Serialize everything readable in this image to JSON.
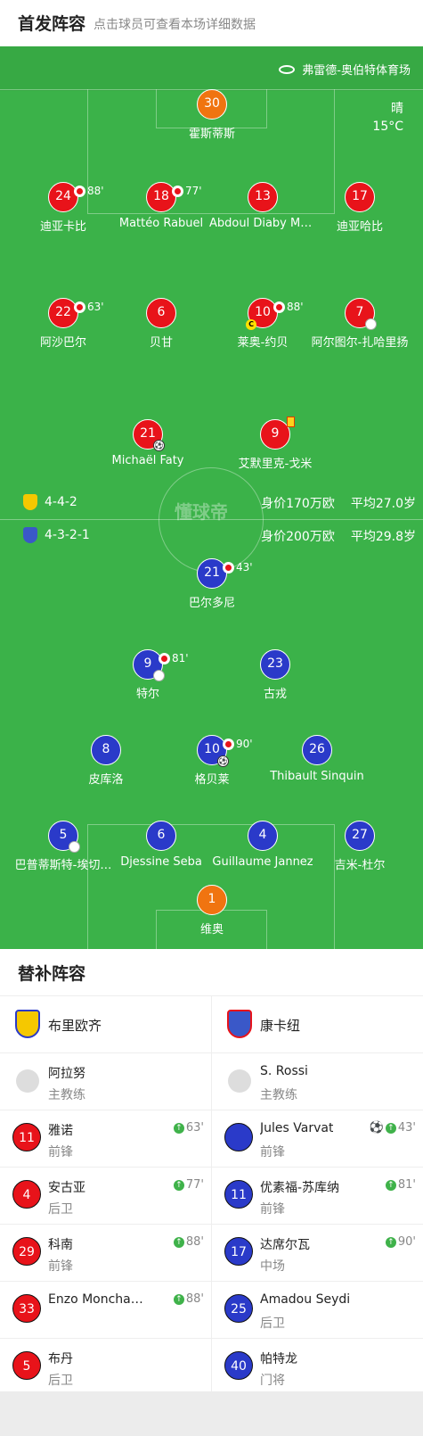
{
  "header": {
    "title": "首发阵容",
    "subtitle": "点击球员可查看本场详细数据"
  },
  "venue": {
    "name": "弗雷德-奥伯特体育场"
  },
  "weather": {
    "condition": "晴",
    "temp": "15°C"
  },
  "watermark": "懂球帝",
  "home": {
    "formation": "4-4-2",
    "value": "身价170万欧",
    "avg_age": "平均27.0岁",
    "players": [
      {
        "number": "30",
        "name": "霍斯蒂斯",
        "color": "orange"
      },
      {
        "number": "24",
        "name": "迪亚卡比",
        "sub": "88'"
      },
      {
        "number": "18",
        "name": "Mattéo Rabuel",
        "sub": "77'"
      },
      {
        "number": "13",
        "name": "Abdoul Diaby Ma…"
      },
      {
        "number": "17",
        "name": "迪亚哈比"
      },
      {
        "number": "22",
        "name": "阿沙巴尔",
        "sub": "63'"
      },
      {
        "number": "6",
        "name": "贝甘"
      },
      {
        "number": "10",
        "name": "莱奥-约贝",
        "sub": "88'",
        "captain": "C"
      },
      {
        "number": "7",
        "name": "阿尔图尔-扎哈里扬"
      },
      {
        "number": "21",
        "name": "Michaël Faty"
      },
      {
        "number": "9",
        "name": "艾默里克-戈米"
      }
    ]
  },
  "away": {
    "formation": "4-3-2-1",
    "value": "身价200万欧",
    "avg_age": "平均29.8岁",
    "players": [
      {
        "number": "21",
        "name": "巴尔多尼",
        "sub": "43'"
      },
      {
        "number": "9",
        "name": "特尔",
        "sub": "81'"
      },
      {
        "number": "23",
        "name": "古戎"
      },
      {
        "number": "8",
        "name": "皮库洛"
      },
      {
        "number": "10",
        "name": "格贝莱",
        "sub": "90'"
      },
      {
        "number": "26",
        "name": "Thibault Sinquin"
      },
      {
        "number": "5",
        "name": "巴普蒂斯特-埃切…"
      },
      {
        "number": "6",
        "name": "Djessine Seba"
      },
      {
        "number": "4",
        "name": "Guillaume Jannez"
      },
      {
        "number": "27",
        "name": "吉米-杜尔"
      },
      {
        "number": "1",
        "name": "维奥",
        "color": "orange"
      }
    ]
  },
  "subs": {
    "title": "替补阵容",
    "home": {
      "team": "布里欧齐",
      "coach": {
        "name": "阿拉努",
        "role": "主教练"
      },
      "list": [
        {
          "number": "11",
          "name": "雅诺",
          "role": "前锋",
          "event": "63'"
        },
        {
          "number": "4",
          "name": "安古亚",
          "role": "后卫",
          "event": "77'"
        },
        {
          "number": "29",
          "name": "科南",
          "role": "前锋",
          "event": "88'"
        },
        {
          "number": "33",
          "name": "Enzo Moncha…",
          "role": "",
          "event": "88'"
        },
        {
          "number": "5",
          "name": "布丹",
          "role": "后卫",
          "event": ""
        }
      ]
    },
    "away": {
      "team": "康卡纽",
      "coach": {
        "name": "S. Rossi",
        "role": "主教练"
      },
      "list": [
        {
          "number": "",
          "name": "Jules Varvat",
          "role": "前锋",
          "event": "43'"
        },
        {
          "number": "11",
          "name": "优素福-苏库纳",
          "role": "前锋",
          "event": "81'"
        },
        {
          "number": "17",
          "name": "达席尔瓦",
          "role": "中场",
          "event": "90'"
        },
        {
          "number": "25",
          "name": "Amadou Seydi",
          "role": "后卫",
          "event": ""
        },
        {
          "number": "40",
          "name": "帕特龙",
          "role": "门将",
          "event": ""
        }
      ]
    }
  },
  "colors": {
    "pitch": "#3bb249",
    "home": "#e8131a",
    "away": "#2a3ac9",
    "keeper": "#f07410"
  }
}
